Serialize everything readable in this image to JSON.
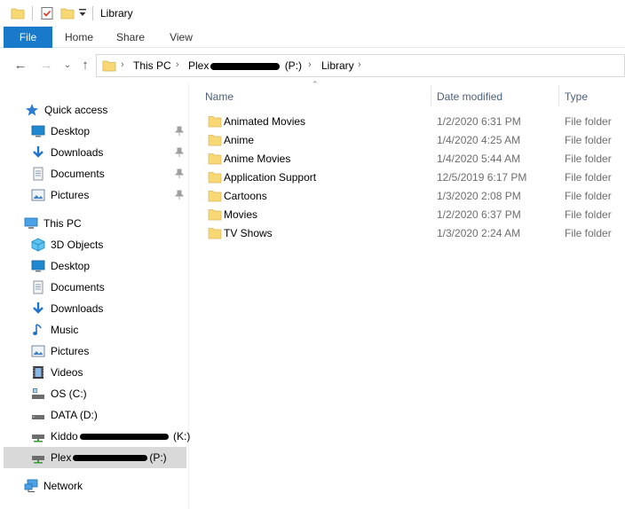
{
  "window": {
    "title": "Library"
  },
  "ribbon": {
    "tabs": [
      {
        "label": "File",
        "active": true
      },
      {
        "label": "Home"
      },
      {
        "label": "Share"
      },
      {
        "label": "View"
      }
    ]
  },
  "address": {
    "crumbs": [
      "This PC",
      "Plex (\\\\192.168.0.4) (P:)",
      "Library"
    ],
    "crumb_plex_prefix": "Plex",
    "crumb_plex_suffix": "(P:)"
  },
  "sidebar": {
    "quick_access": {
      "label": "Quick access"
    },
    "quick_items": [
      {
        "label": "Desktop",
        "icon": "desktop-icon",
        "pinned": true
      },
      {
        "label": "Downloads",
        "icon": "downloads-icon",
        "pinned": true
      },
      {
        "label": "Documents",
        "icon": "documents-icon",
        "pinned": true
      },
      {
        "label": "Pictures",
        "icon": "pictures-icon",
        "pinned": true
      }
    ],
    "this_pc": {
      "label": "This PC"
    },
    "pc_items": [
      {
        "label": "3D Objects",
        "icon": "3d-objects-icon"
      },
      {
        "label": "Desktop",
        "icon": "desktop-icon"
      },
      {
        "label": "Documents",
        "icon": "documents-icon"
      },
      {
        "label": "Downloads",
        "icon": "downloads-icon"
      },
      {
        "label": "Music",
        "icon": "music-icon"
      },
      {
        "label": "Pictures",
        "icon": "pictures-icon"
      },
      {
        "label": "Videos",
        "icon": "videos-icon"
      },
      {
        "label": "OS (C:)",
        "icon": "os-drive-icon"
      },
      {
        "label": "DATA (D:)",
        "icon": "drive-icon"
      }
    ],
    "network_drives": [
      {
        "prefix": "Kiddo",
        "suffix": "(K:)",
        "icon": "network-drive-icon",
        "selected": false
      },
      {
        "prefix": "Plex",
        "suffix": "(P:)",
        "icon": "network-drive-icon",
        "selected": true
      }
    ],
    "network": {
      "label": "Network"
    }
  },
  "columns": {
    "name": "Name",
    "date_modified": "Date modified",
    "type": "Type"
  },
  "files": [
    {
      "name": "Animated Movies",
      "date": "1/2/2020 6:31 PM",
      "type": "File folder"
    },
    {
      "name": "Anime",
      "date": "1/4/2020 4:25 AM",
      "type": "File folder"
    },
    {
      "name": "Anime Movies",
      "date": "1/4/2020 5:44 AM",
      "type": "File folder"
    },
    {
      "name": "Application Support",
      "date": "12/5/2019 6:17 PM",
      "type": "File folder"
    },
    {
      "name": "Cartoons",
      "date": "1/3/2020 2:08 PM",
      "type": "File folder"
    },
    {
      "name": "Movies",
      "date": "1/2/2020 6:37 PM",
      "type": "File folder"
    },
    {
      "name": "TV Shows",
      "date": "1/3/2020 2:24 AM",
      "type": "File folder"
    }
  ],
  "colors": {
    "accent": "#1979ca",
    "folder": "#f8d775",
    "header_text": "#4c607a",
    "secondary_text": "#6d6d6d",
    "selection": "#d9d9d9"
  }
}
